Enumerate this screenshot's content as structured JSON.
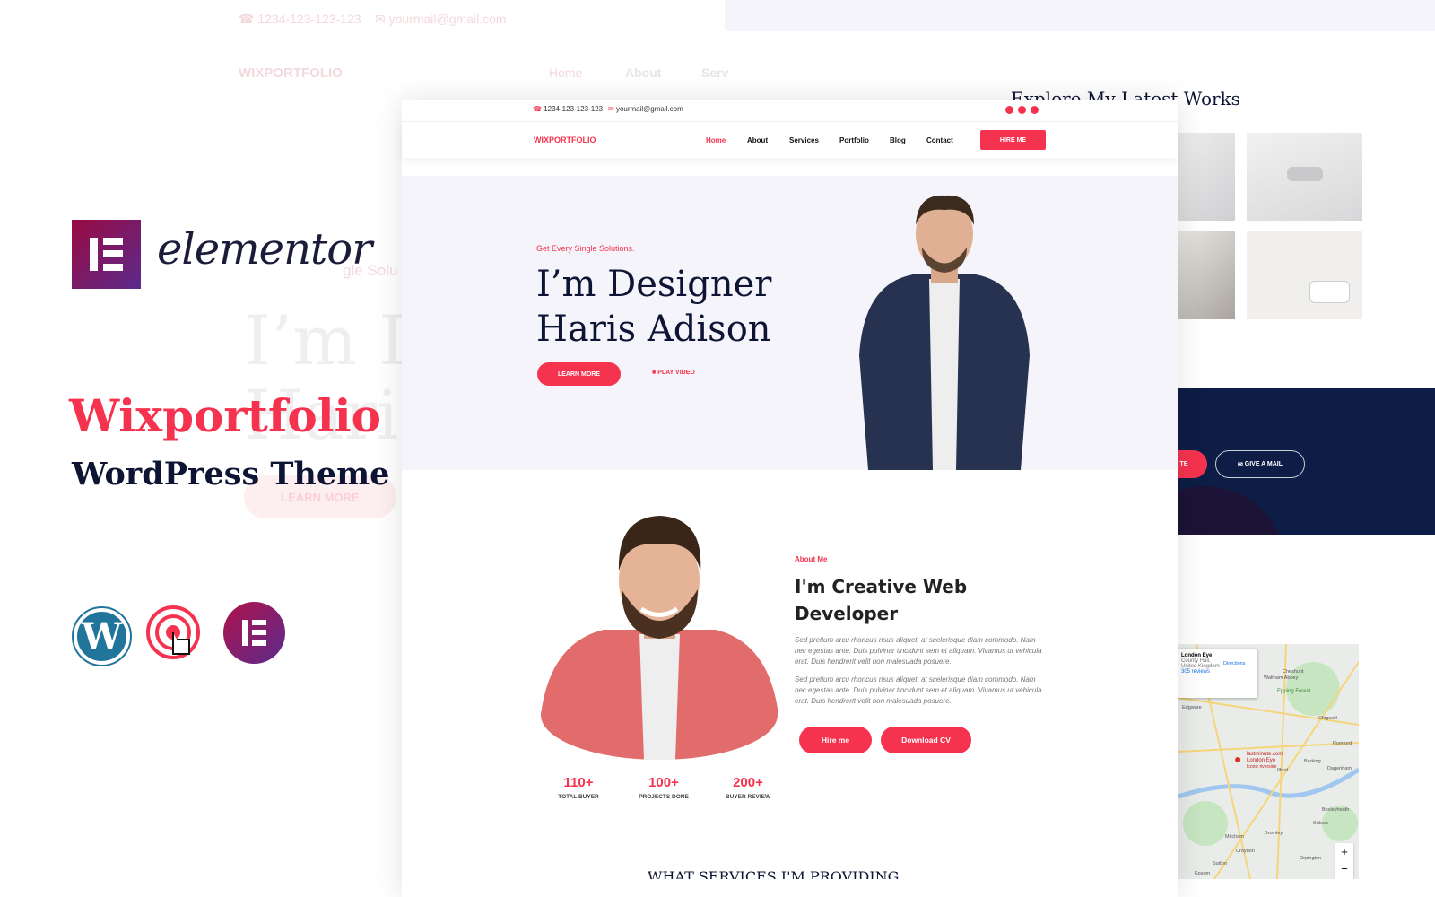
{
  "background": {
    "phone": "1234-123-123-123",
    "email": "yourmail@gmail.com",
    "brand": "WIXPORTFOLIO",
    "nav": [
      "Home",
      "About",
      "Serv"
    ],
    "tagline_partial": "gle Solu",
    "headline_partial_1": "I’m D",
    "headline_partial_2": "Haris",
    "button_partial": "LEARN MORE",
    "works_title": "Explore My Latest Works",
    "banner_button_partial": "TE",
    "banner_button_mail": "GIVE A MAIL",
    "services_title": "WHAT SERVICES I'M PROVIDING",
    "map": {
      "place": "London Eye",
      "address_1": "County Hall,",
      "address_2": "United Kingdom",
      "reviews": "305 reviews",
      "directions": "Directions",
      "pin_label_1": "lastminute.com",
      "pin_label_2": "London Eye",
      "pin_label_3": "Iconic riverside",
      "places": [
        "Cheshunt",
        "Waltham Abbey",
        "Epping",
        "Epping Forest",
        "Chigwell",
        "Edgware",
        "Ilford",
        "Barking",
        "Dagenham",
        "Romford",
        "Bexleyheath",
        "Sidcup",
        "Bromley",
        "Mitcham",
        "Croydon",
        "Orpington",
        "Sutton",
        "Epsom"
      ]
    }
  },
  "promo": {
    "logo_text": "elementor",
    "title": "Wixportfolio",
    "subtitle": "WordPress Theme",
    "icons": [
      "wordpress-icon",
      "touch-icon",
      "elementor-icon"
    ]
  },
  "mockup": {
    "topbar": {
      "phone": "1234-123-123-123",
      "email": "yourmail@gmail.com",
      "social": [
        "instagram-icon",
        "twitter-icon",
        "youtube-icon"
      ]
    },
    "nav": {
      "brand": "WIXPORTFOLIO",
      "items": [
        "Home",
        "About",
        "Services",
        "Portfolio",
        "Blog",
        "Contact"
      ],
      "active": "Home",
      "cta": "HIRE ME"
    },
    "hero": {
      "tagline": "Get Every Single Solutions.",
      "line1": "I’m Designer",
      "line2": "Haris Adison",
      "learn_more": "LEARN MORE",
      "play_video": "PLAY VIDEO"
    },
    "about": {
      "label": "About Me",
      "title_1": "I'm Creative Web",
      "title_2": "Developer",
      "para_1": "Sed pretium arcu rhoncus risus aliquet, at scelerisque diam commodo. Nam nec egestas ante. Duis pulvinar tincidunt sem et aliquam. Vivamus ut vehicula erat. Duis hendrerit velit non malesuada posuere.",
      "para_2": "Sed pretium arcu rhoncus risus aliquet, at scelerisque diam commodo. Nam nec egestas ante. Duis pulvinar tincidunt sem et aliquam. Vivamus ut vehicula erat. Duis hendrerit velit non malesuada posuere.",
      "hire": "Hire me",
      "download": "Download CV",
      "stats": [
        {
          "value": "110+",
          "label": "TOTAL BUYER"
        },
        {
          "value": "100+",
          "label": "PROJECTS DONE"
        },
        {
          "value": "200+",
          "label": "BUYER REVIEW"
        }
      ]
    }
  },
  "colors": {
    "accent": "#f5334f",
    "navy": "#0e1433",
    "hero_bg": "#f5f4fb",
    "banner": "#0d1d45"
  }
}
